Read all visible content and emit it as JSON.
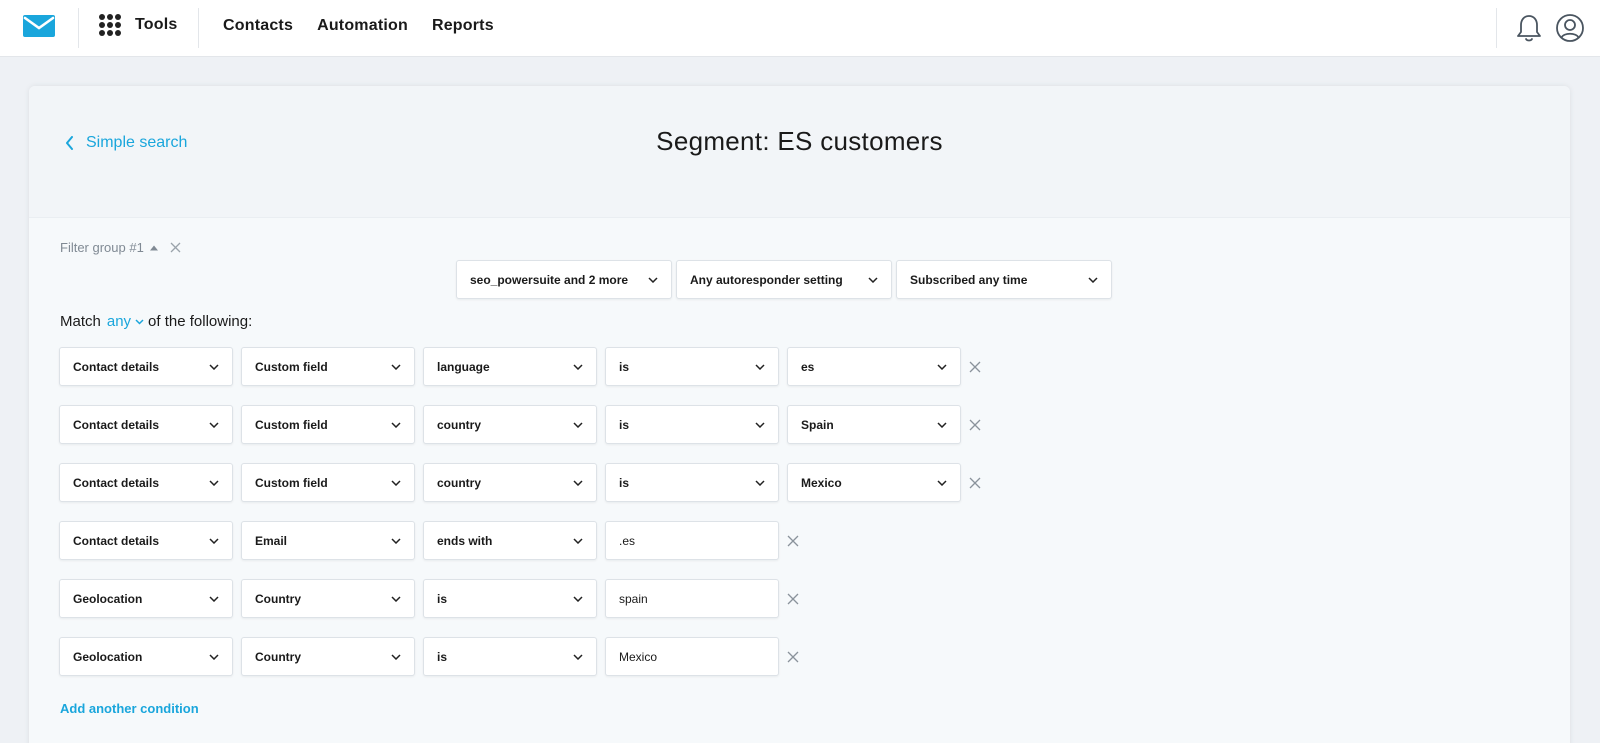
{
  "topbar": {
    "tools_label": "Tools",
    "nav": [
      "Contacts",
      "Automation",
      "Reports"
    ]
  },
  "header": {
    "back_label": "Simple search",
    "title": "Segment: ES customers"
  },
  "filter_group": {
    "label": "Filter group #1",
    "top_filters": [
      "seo_powersuite and 2 more",
      "Any autoresponder setting",
      "Subscribed any time"
    ],
    "match_prefix": "Match",
    "match_mode": "any",
    "match_suffix": "of the following:",
    "conditions": [
      {
        "category": "Contact details",
        "field_type": "Custom field",
        "field": "language",
        "operator": "is",
        "value": "es"
      },
      {
        "category": "Contact details",
        "field_type": "Custom field",
        "field": "country",
        "operator": "is",
        "value": "Spain"
      },
      {
        "category": "Contact details",
        "field_type": "Custom field",
        "field": "country",
        "operator": "is",
        "value": "Mexico"
      },
      {
        "category": "Contact details",
        "field_type": "Email",
        "operator": "ends with",
        "value": ".es"
      },
      {
        "category": "Geolocation",
        "field_type": "Country",
        "operator": "is",
        "value": "spain"
      },
      {
        "category": "Geolocation",
        "field_type": "Country",
        "operator": "is",
        "value": "Mexico"
      }
    ],
    "add_label": "Add another condition"
  },
  "colors": {
    "accent": "#1aa6dc",
    "text": "#1a1a1a",
    "muted": "#808a94"
  }
}
